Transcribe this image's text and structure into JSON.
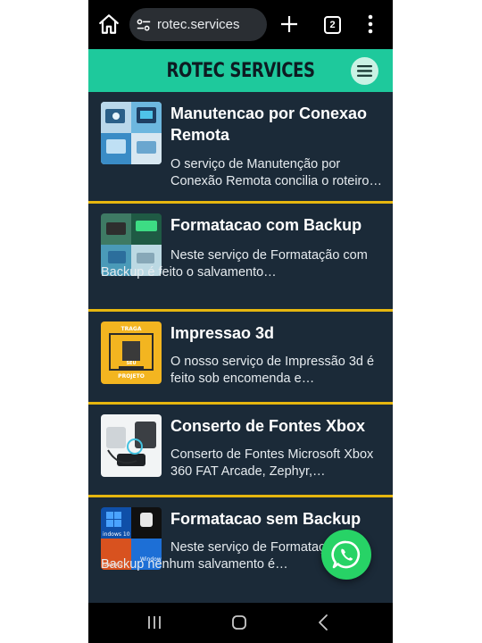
{
  "browser": {
    "url": "rotec.services",
    "tab_count": "2"
  },
  "site": {
    "brand": "ROTEC SERVICES"
  },
  "services": [
    {
      "title": "Manutencao por Conexao Remota",
      "description": "O serviço de Manutenção por Conexão Remota concilia o roteiro…"
    },
    {
      "title": "Formatacao com Backup",
      "description": "Neste serviço de Formatação com Backup é feito o salvamento…"
    },
    {
      "title": "Impressao 3d",
      "description": "O nosso serviço de Impressão 3d é feito sob encomenda e…"
    },
    {
      "title": "Conserto de Fontes Xbox",
      "description": "Conserto de Fontes Microsoft Xbox 360 FAT Arcade, Zephyr,…"
    },
    {
      "title": "Formatacao sem Backup",
      "description": "Neste serviço de Formatação sem Backup nenhum salvamento é…"
    }
  ],
  "thumb_texts": {
    "print3d_line1": "TRAGA",
    "print3d_line2": "SEU",
    "print3d_line3": "PROJETO",
    "os_label_1": "indows 10",
    "os_label_2": "ubuntu",
    "os_label_3": "Window"
  },
  "icons": {
    "home": "home-icon",
    "site_settings": "tune-icon",
    "new_tab": "plus-icon",
    "more": "more-vert-icon",
    "menu": "hamburger-icon",
    "whatsapp": "whatsapp-icon",
    "recents": "recents-icon",
    "nav_home": "nav-home-icon",
    "back": "back-icon"
  },
  "colors": {
    "header": "#1ec99c",
    "card_bg": "#1b2a38",
    "divider": "#e6b60f",
    "whatsapp": "#27d366"
  }
}
